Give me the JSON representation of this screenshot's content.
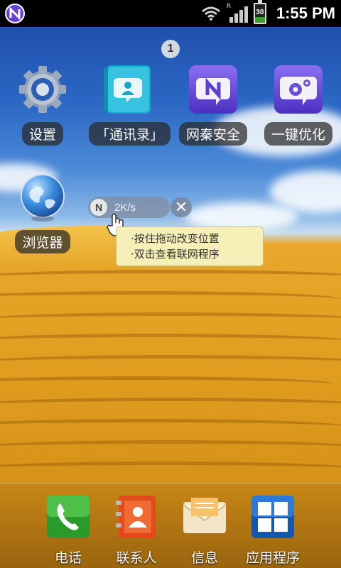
{
  "status_bar": {
    "time": "1:55 PM",
    "battery_text": "30",
    "battery_level": 0.3,
    "signal_roaming_indicator": "R",
    "icons": [
      "netqin-notification-icon",
      "wifi-icon",
      "signal-icon",
      "battery-icon"
    ]
  },
  "home": {
    "page_number": "1",
    "apps": [
      {
        "label": "设置",
        "icon": "settings-gear-icon"
      },
      {
        "label": "「通讯录」",
        "icon": "address-book-icon"
      },
      {
        "label": "网秦安全",
        "icon": "netqin-security-icon"
      },
      {
        "label": "一键优化",
        "icon": "one-click-optimize-icon"
      },
      {
        "label": "浏览器",
        "icon": "browser-globe-icon"
      }
    ]
  },
  "net_widget": {
    "logo_text": "N",
    "speed": "2K/s",
    "close_symbol": "✕",
    "tooltip_lines": [
      "·按住拖动改变位置",
      "·双击查看联网程序"
    ]
  },
  "dock": {
    "items": [
      {
        "label": "电话",
        "icon": "phone-icon"
      },
      {
        "label": "联系人",
        "icon": "contacts-icon"
      },
      {
        "label": "信息",
        "icon": "messages-icon"
      },
      {
        "label": "应用程序",
        "icon": "apps-grid-icon"
      }
    ]
  },
  "colors": {
    "status_bar_bg": "#000000",
    "tooltip_bg": "#f6f0b8",
    "label_bg": "#282828",
    "netqin_purple": "#5b3fd0"
  }
}
